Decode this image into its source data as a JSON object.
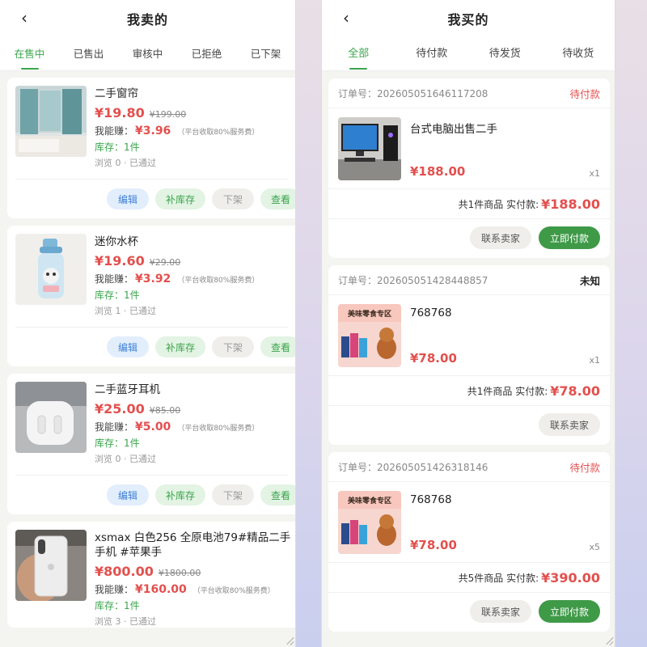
{
  "left": {
    "title": "我卖的",
    "tabs": [
      "在售中",
      "已售出",
      "审核中",
      "已拒绝",
      "已下架"
    ],
    "fee_note": "（平台收取80%服务费）",
    "earn_label": "我能赚：",
    "buttons": {
      "edit": "编辑",
      "restock": "补库存",
      "delist": "下架",
      "view": "查看"
    },
    "items": [
      {
        "title": "二手窗帘",
        "price": "¥19.80",
        "original": "¥199.00",
        "earn": "¥3.96",
        "stock": "库存：1件",
        "meta": "浏览 0 · 已通过",
        "image": "curtain-photo"
      },
      {
        "title": "迷你水杯",
        "price": "¥19.60",
        "original": "¥29.00",
        "earn": "¥3.92",
        "stock": "库存：1件",
        "meta": "浏览 1 · 已通过",
        "image": "water-bottle-photo"
      },
      {
        "title": "二手蓝牙耳机",
        "price": "¥25.00",
        "original": "¥85.00",
        "earn": "¥5.00",
        "stock": "库存：1件",
        "meta": "浏览 0 · 已通过",
        "image": "earbuds-photo"
      },
      {
        "title": "xsmax 白色256 全原电池79#精品二手手机 #苹果手",
        "price": "¥800.00",
        "original": "¥1800.00",
        "earn": "¥160.00",
        "stock": "库存：1件",
        "meta": "浏览 3 · 已通过",
        "image": "iphone-photo"
      }
    ]
  },
  "right": {
    "title": "我买的",
    "tabs": [
      "全部",
      "待付款",
      "待发货",
      "待收货"
    ],
    "order_prefix": "订单号：",
    "buttons": {
      "contact": "联系卖家",
      "pay": "立即付款"
    },
    "orders": [
      {
        "order_no": "订单号：20260505164611720​8",
        "status": "待付款",
        "title": "台式电脑出售二手",
        "price": "¥188.00",
        "qty": "x1",
        "summary": "共1件商品 实付款:",
        "total": "¥188.00",
        "image": "desktop-pc-photo"
      },
      {
        "order_no": "订单号：202605051428448857",
        "status": "未知",
        "title": "768768",
        "price": "¥78.00",
        "qty": "x1",
        "summary": "共1件商品 实付款:",
        "total": "¥78.00",
        "image": "snack-banner-photo",
        "banner": "美味零食专区"
      },
      {
        "order_no": "订单号：202605051426318146",
        "status": "待付款",
        "title": "768768",
        "price": "¥78.00",
        "qty": "x5",
        "summary": "共5件商品 实付款:",
        "total": "¥390.00",
        "image": "snack-banner-photo",
        "banner": "美味零食专区"
      }
    ]
  }
}
